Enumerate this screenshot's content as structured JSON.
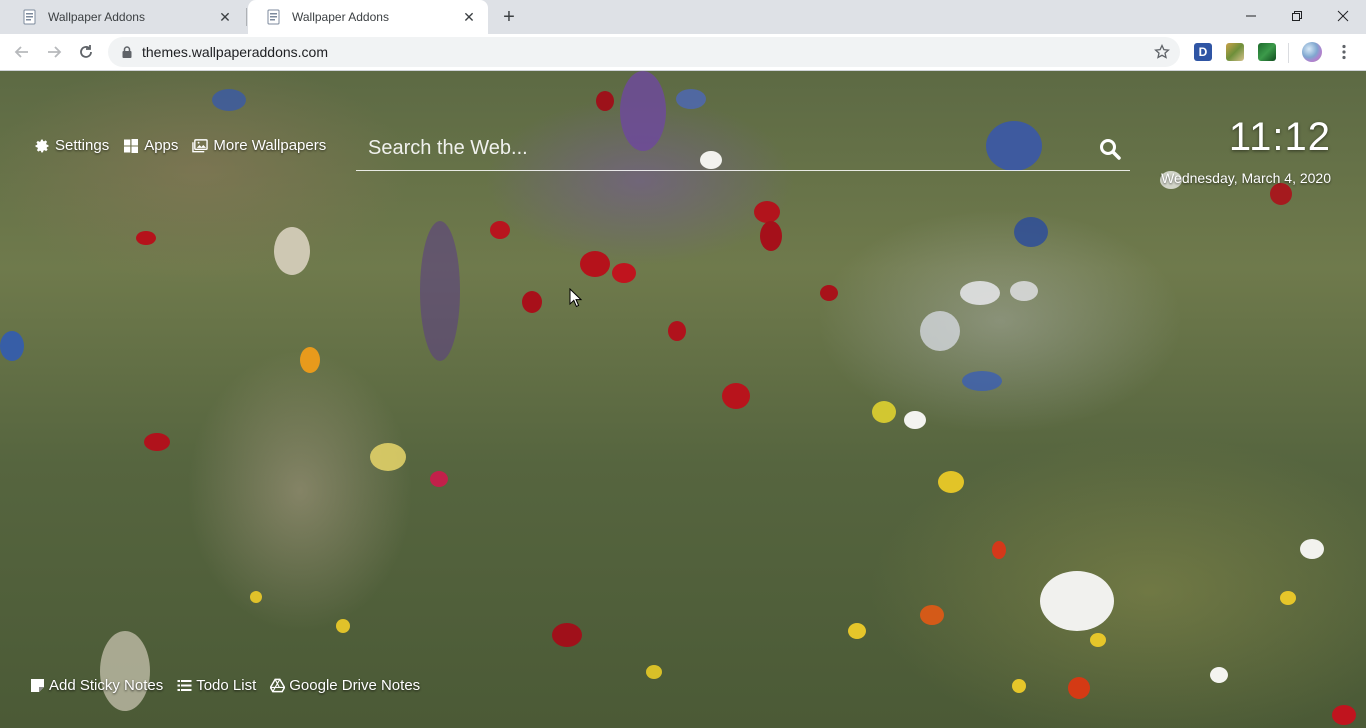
{
  "browser": {
    "tabs": [
      {
        "title": "Wallpaper Addons",
        "active": false
      },
      {
        "title": "Wallpaper Addons",
        "active": true
      }
    ],
    "close_glyph": "✕",
    "new_tab_glyph": "+",
    "window_controls": {
      "minimize": "—",
      "maximize": "❐",
      "close": "✕"
    },
    "url": "themes.wallpaperaddons.com",
    "extensions": [
      {
        "name": "d-extension-icon",
        "label": "D"
      },
      {
        "name": "photo-extension-icon"
      },
      {
        "name": "green-extension-icon"
      }
    ]
  },
  "page": {
    "top_links": [
      {
        "label": "Settings",
        "icon": "gear-icon"
      },
      {
        "label": "Apps",
        "icon": "apps-grid-icon"
      },
      {
        "label": "More Wallpapers",
        "icon": "image-icon"
      }
    ],
    "search": {
      "placeholder": "Search the Web..."
    },
    "clock": {
      "time": "11:12",
      "date": "Wednesday, March 4, 2020"
    },
    "bottom_links": [
      {
        "label": "Add Sticky Notes",
        "icon": "sticky-note-icon"
      },
      {
        "label": "Todo List",
        "icon": "list-icon"
      },
      {
        "label": "Google Drive Notes",
        "icon": "google-drive-icon"
      }
    ]
  },
  "colors": {
    "tabstrip": "#dee1e6",
    "toolbar": "#ffffff",
    "omnibox": "#f1f3f4",
    "page_text": "#ffffff"
  }
}
